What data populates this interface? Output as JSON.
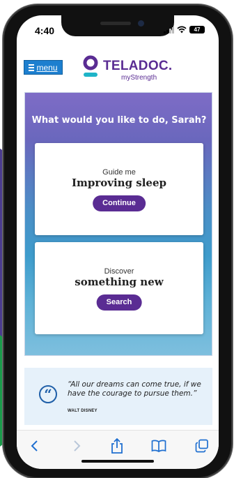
{
  "status": {
    "time": "4:40",
    "battery": "47"
  },
  "header": {
    "menu_label": "menu",
    "brand": "TELADOC.",
    "brand_sub": "myStrength"
  },
  "hero": {
    "title": "What would you like to do, Sarah?",
    "cards": [
      {
        "eyebrow": "Guide me",
        "title": "Improving sleep",
        "button": "Continue"
      },
      {
        "eyebrow": "Discover",
        "title": "something new",
        "button": "Search"
      }
    ]
  },
  "quote": {
    "text": "“All our dreams can come true, if we have the courage to pursue them.”",
    "author": "WALT DISNEY"
  },
  "colors": {
    "brand": "#5a2c93",
    "menu_blue": "#1d7fcf",
    "quote_bg": "#e6f1fa"
  },
  "icons": {
    "toolbar": [
      "back-icon",
      "forward-icon",
      "share-icon",
      "bookmarks-icon",
      "tabs-icon"
    ]
  }
}
